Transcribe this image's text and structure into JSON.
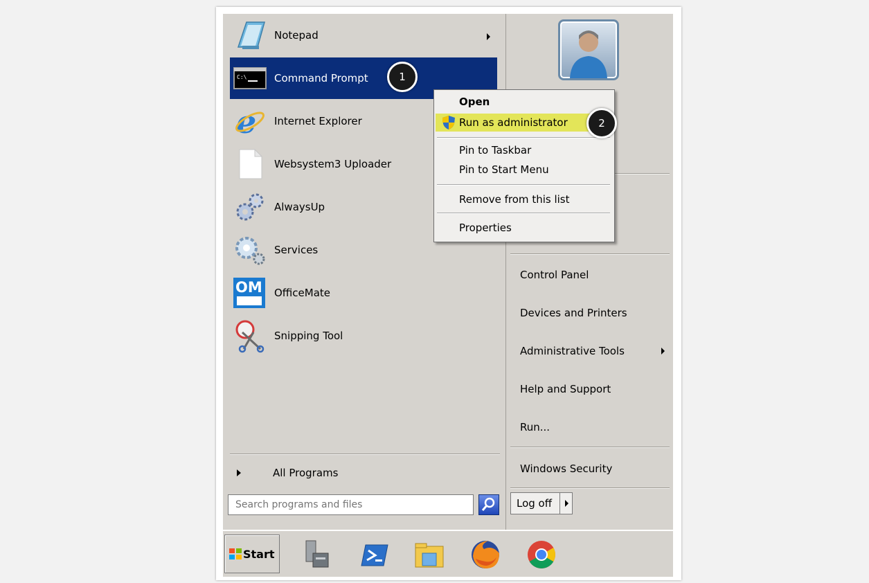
{
  "programs": [
    {
      "label": "Notepad",
      "icon": "notepad-icon",
      "has_submenu": true
    },
    {
      "label": "Command Prompt",
      "icon": "command-prompt-icon",
      "selected": true
    },
    {
      "label": "Internet Explorer",
      "icon": "internet-explorer-icon"
    },
    {
      "label": "Websystem3 Uploader",
      "icon": "blank-file-icon"
    },
    {
      "label": "AlwaysUp",
      "icon": "gears-icon"
    },
    {
      "label": "Services",
      "icon": "services-icon"
    },
    {
      "label": "OfficeMate",
      "icon": "officemate-icon",
      "icon_text": "OM"
    },
    {
      "label": "Snipping Tool",
      "icon": "snipping-tool-icon"
    }
  ],
  "all_programs": {
    "label": "All Programs"
  },
  "search": {
    "placeholder": "Search programs and files"
  },
  "right_links": [
    {
      "label": "Control Panel"
    },
    {
      "label": "Devices and Printers"
    },
    {
      "label": "Administrative Tools",
      "has_submenu": true
    },
    {
      "label": "Help and Support"
    },
    {
      "label": "Run..."
    },
    {
      "label": "Windows Security"
    }
  ],
  "log_off": {
    "label": "Log off"
  },
  "context_menu": {
    "items": [
      {
        "label": "Open",
        "bold": true
      },
      {
        "label": "Run as administrator",
        "highlighted": true
      },
      {
        "label": "Pin to Taskbar"
      },
      {
        "label": "Pin to Start Menu"
      },
      {
        "label": "Remove from this list"
      },
      {
        "label": "Properties"
      }
    ]
  },
  "callouts": [
    {
      "number": "1"
    },
    {
      "number": "2"
    }
  ],
  "taskbar": {
    "start_label": "Start",
    "icons": [
      "server-manager-icon",
      "powershell-icon",
      "file-explorer-icon",
      "firefox-icon",
      "chrome-icon"
    ]
  },
  "colors": {
    "menu_bg": "#d6d3ce",
    "selection": "#0a2d7a",
    "highlight": "#e3e559"
  }
}
